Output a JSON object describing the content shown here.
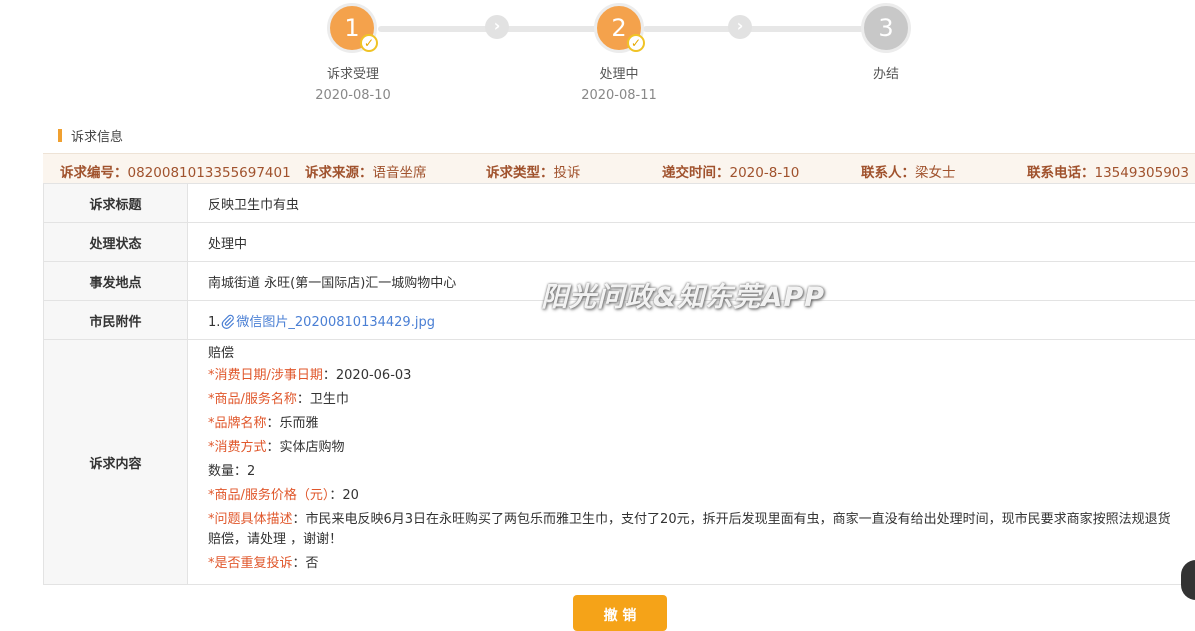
{
  "steps": [
    {
      "number": "1",
      "label": "诉求受理",
      "date": "2020-08-10",
      "done": true
    },
    {
      "number": "2",
      "label": "处理中",
      "date": "2020-08-11",
      "done": true
    },
    {
      "number": "3",
      "label": "办结",
      "date": "",
      "done": false
    }
  ],
  "check_glyph": "✓",
  "arrow_glyph": "›",
  "section_title": "诉求信息",
  "info_bar": {
    "id_key": "诉求编号：",
    "id_value": "082008101335569740​1",
    "source_key": "诉求来源：",
    "source_value": "语音坐席",
    "type_key": "诉求类型：",
    "type_value": "投诉",
    "time_key": "递交时间：",
    "time_value": "2020-8-10",
    "contact_key": "联系人：",
    "contact_value": "梁女士",
    "phone_key": "联系电话：",
    "phone_value": "13549305903"
  },
  "rows": {
    "title_label": "诉求标题",
    "title_value": "反映卫生巾有虫",
    "status_label": "处理状态",
    "status_value": "处理中",
    "location_label": "事发地点",
    "location_value": "南城街道 永旺(第一国际店)汇一城购物中心",
    "attachment_label": "市民附件",
    "attachment_index": "1.",
    "attachment_icon": "paperclip-icon",
    "attachment_name": "微信图片_20200810134429.jpg",
    "content_label": "诉求内容"
  },
  "content": {
    "line0": "赔偿",
    "consume_date_key": "*消费日期/涉事日期",
    "consume_date_value": "：2020-06-03",
    "product_key": "*商品/服务名称",
    "product_value": "：卫生巾",
    "brand_key": "*品牌名称",
    "brand_value": "：乐而雅",
    "method_key": "*消费方式",
    "method_value": "：实体店购物",
    "quantity": "数量：2",
    "price_key": "*商品/服务价格（元）",
    "price_value": "：20",
    "desc_key": "*问题具体描述",
    "desc_value": "：市民来电反映6月3日在永旺购买了两包乐而雅卫生巾，支付了20元，拆开后发现里面有虫，商家一直没有给出处理时间，现市民要求商家按照法规退货赔偿，请处理 ，谢谢！",
    "repeat_key": "*是否重复投诉",
    "repeat_value": "：否"
  },
  "watermark": "阳光问政&知东莞APP",
  "cancel_label": "撤 销",
  "colors": {
    "accent": "#f4a24c",
    "info_text": "#a0522d",
    "required": "#e0572b",
    "link": "#4a7fd4",
    "button": "#f5a318"
  }
}
